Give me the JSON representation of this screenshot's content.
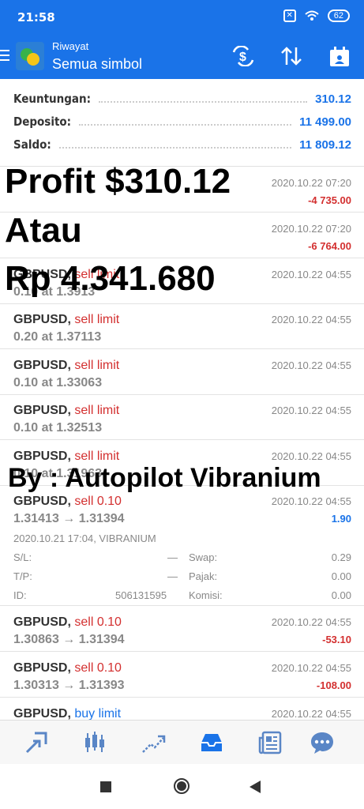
{
  "status_bar": {
    "time": "21:58",
    "battery": "62"
  },
  "header": {
    "subtitle": "Riwayat",
    "title": "Semua simbol"
  },
  "summary": [
    {
      "label": "Keuntungan:",
      "value": "310.12"
    },
    {
      "label": "Deposito:",
      "value": "11 499.00"
    },
    {
      "label": "Saldo:",
      "value": "11 809.12"
    }
  ],
  "items": [
    {
      "symbol": "",
      "type": "",
      "detail": "",
      "time": "2020.10.22 07:20",
      "profit": "-4 735.00"
    },
    {
      "symbol": "",
      "type": "",
      "detail": "",
      "time": "2020.10.22 07:20",
      "profit": "-6 764.00"
    },
    {
      "symbol": "GBPUSD,",
      "type": "sell limit",
      "detail": "0.10 at 1.3913",
      "time": "2020.10.22 04:55",
      "profit": ""
    },
    {
      "symbol": "GBPUSD,",
      "type": "sell limit",
      "detail": "0.20 at 1.37113",
      "time": "2020.10.22 04:55",
      "profit": ""
    },
    {
      "symbol": "GBPUSD,",
      "type": "sell limit",
      "detail": "0.10 at 1.33063",
      "time": "2020.10.22 04:55",
      "profit": ""
    },
    {
      "symbol": "GBPUSD,",
      "type": "sell limit",
      "detail": "0.10 at 1.32513",
      "time": "2020.10.22 04:55",
      "profit": ""
    },
    {
      "symbol": "GBPUSD,",
      "type": "sell limit",
      "detail": "0.10 at 1.31963",
      "time": "2020.10.22 04:55",
      "profit": ""
    },
    {
      "symbol": "GBPUSD,",
      "type": "sell 0.10",
      "detail": "1.31413 → 1.31394",
      "time": "2020.10.22 04:55",
      "profit": "1.90"
    },
    {
      "symbol": "GBPUSD,",
      "type": "sell 0.10",
      "detail": "1.30863 → 1.31394",
      "time": "2020.10.22 04:55",
      "profit": "-53.10"
    },
    {
      "symbol": "GBPUSD,",
      "type": "sell 0.10",
      "detail": "1.30313 → 1.31393",
      "time": "2020.10.22 04:55",
      "profit": "-108.00"
    },
    {
      "symbol": "GBPUSD,",
      "type": "buy limit",
      "detail": "",
      "time": "2020.10.22 04:55",
      "profit": ""
    }
  ],
  "expanded": {
    "open_info": "2020.10.21 17:04, VIBRANIUM",
    "sl_label": "S/L:",
    "sl_value": "—",
    "swap_label": "Swap:",
    "swap_value": "0.29",
    "tp_label": "T/P:",
    "tp_value": "—",
    "tax_label": "Pajak:",
    "tax_value": "0.00",
    "id_label": "ID:",
    "id_value": "506131595",
    "commission_label": "Komisi:",
    "commission_value": "0.00"
  },
  "overlay": {
    "line1": "Profit $310.12",
    "line2": "Atau",
    "line3": "Rp 4.341.680",
    "line4": "By : Autopilot Vibranium"
  },
  "bottom_nav": [
    "quotes-icon",
    "chart-icon",
    "trade-icon",
    "history-icon",
    "news-icon",
    "chat-icon"
  ],
  "colors": {
    "accent": "#1a73e8",
    "loss": "#d32f2f",
    "profit": "#1a73e8"
  }
}
